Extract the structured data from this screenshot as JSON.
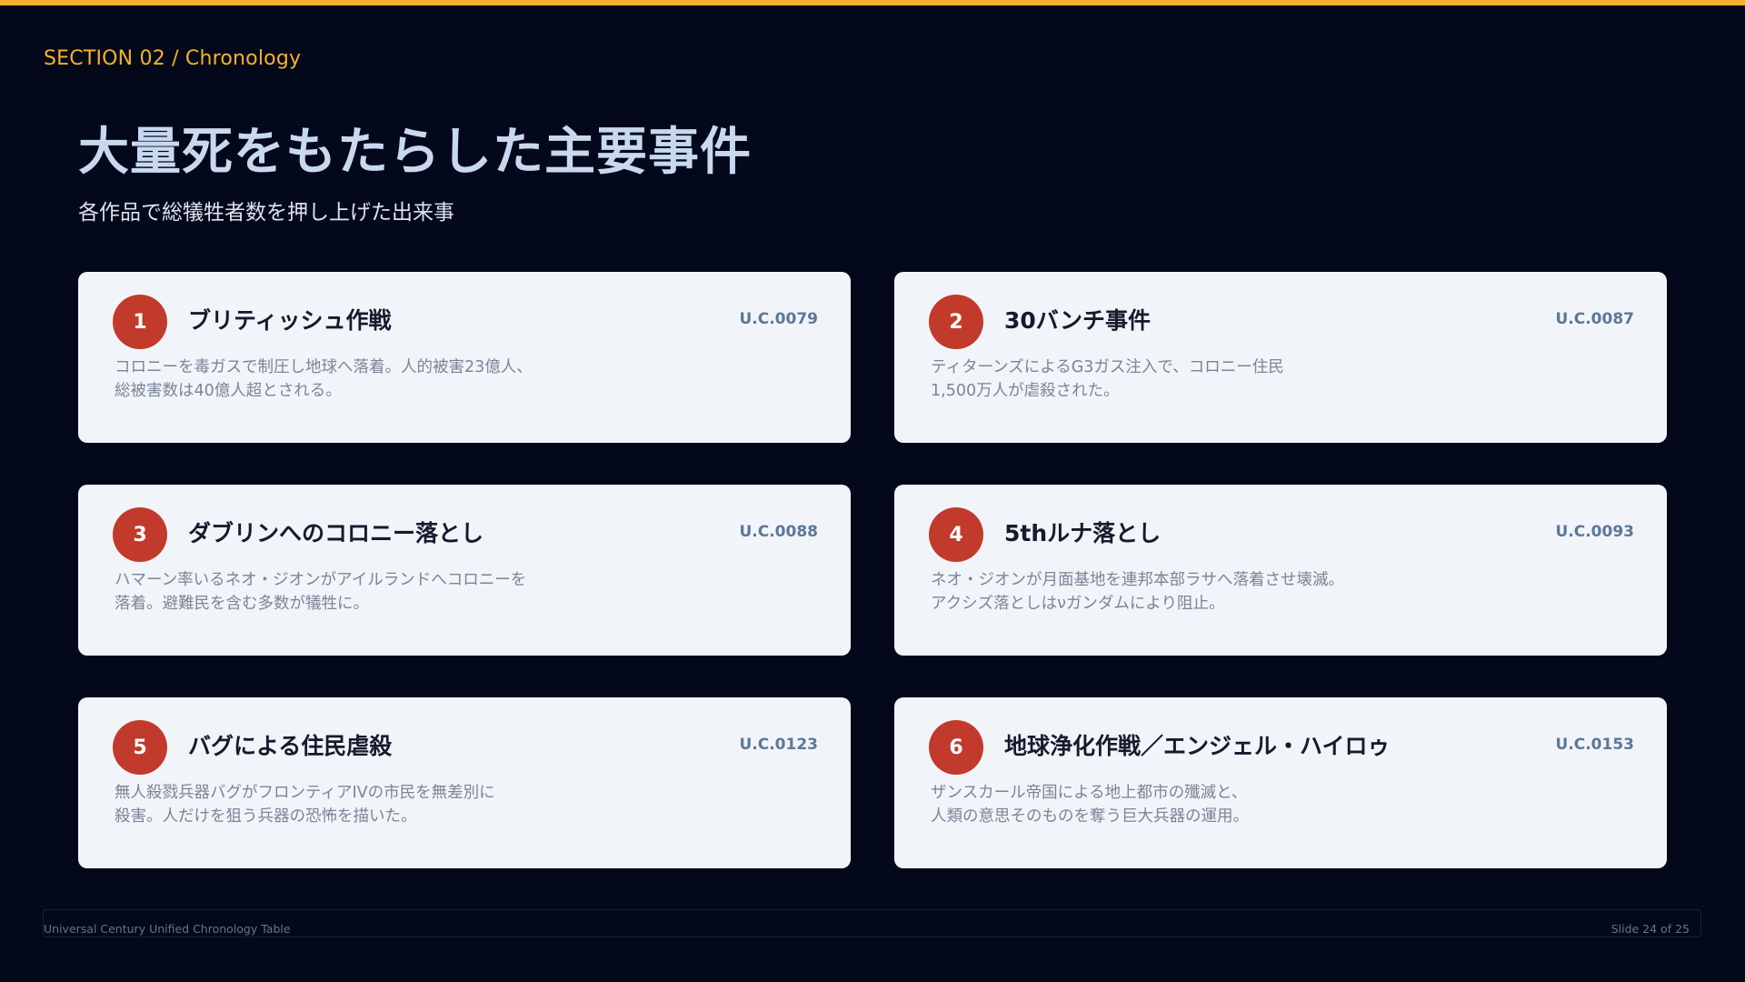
{
  "header": {
    "section_label": "SECTION 02 / Chronology",
    "title": "大量死をもたらした主要事件",
    "subtitle": "各作品で総犠牲者数を押し上げた出来事"
  },
  "colors": {
    "background": "#03081a",
    "accent": "#f4b22c",
    "badge": "#c23a2b",
    "card": "#f1f4f9",
    "date": "#5c7896"
  },
  "events": [
    {
      "number": "1",
      "title": "ブリティッシュ作戦",
      "date": "U.C.0079",
      "desc_line1": "コロニーを毒ガスで制圧し地球へ落着。人的被害23億人、",
      "desc_line2": "総被害数は40億人超とされる。"
    },
    {
      "number": "2",
      "title": "30バンチ事件",
      "date": "U.C.0087",
      "desc_line1": "ティターンズによるG3ガス注入で、コロニー住民",
      "desc_line2": "1,500万人が虐殺された。"
    },
    {
      "number": "3",
      "title": "ダブリンへのコロニー落とし",
      "date": "U.C.0088",
      "desc_line1": "ハマーン率いるネオ・ジオンがアイルランドへコロニーを",
      "desc_line2": "落着。避難民を含む多数が犠牲に。"
    },
    {
      "number": "4",
      "title": "5thルナ落とし",
      "date": "U.C.0093",
      "desc_line1": "ネオ・ジオンが月面基地を連邦本部ラサへ落着させ壊滅。",
      "desc_line2": "アクシズ落としはνガンダムにより阻止。"
    },
    {
      "number": "5",
      "title": "バグによる住民虐殺",
      "date": "U.C.0123",
      "desc_line1": "無人殺戮兵器バグがフロンティアIVの市民を無差別に",
      "desc_line2": "殺害。人だけを狙う兵器の恐怖を描いた。"
    },
    {
      "number": "6",
      "title": "地球浄化作戦／エンジェル・ハイロゥ",
      "date": "U.C.0153",
      "desc_line1": "ザンスカール帝国による地上都市の殲滅と、",
      "desc_line2": "人類の意思そのものを奪う巨大兵器の運用。"
    }
  ],
  "footer": {
    "left": "Universal Century Unified Chronology Table",
    "right": "Slide 24 of 25"
  }
}
